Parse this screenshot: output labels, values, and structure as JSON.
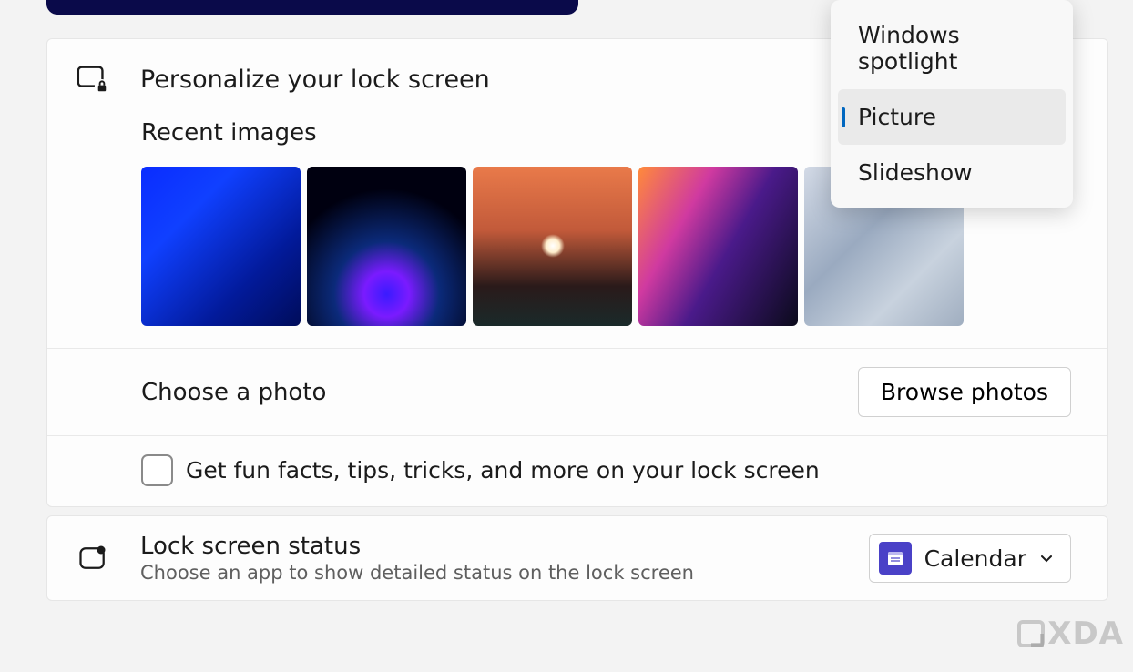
{
  "personalize": {
    "title": "Personalize your lock screen",
    "recent_heading": "Recent images",
    "choose_label": "Choose a photo",
    "browse_label": "Browse photos",
    "funfacts_label": "Get fun facts, tips, tricks, and more on your lock screen"
  },
  "dropdown": {
    "options": [
      {
        "label": "Windows spotlight",
        "selected": false
      },
      {
        "label": "Picture",
        "selected": true
      },
      {
        "label": "Slideshow",
        "selected": false
      }
    ]
  },
  "status": {
    "title": "Lock screen status",
    "subtitle": "Choose an app to show detailed status on the lock screen",
    "app_label": "Calendar"
  },
  "watermark": "XDA"
}
